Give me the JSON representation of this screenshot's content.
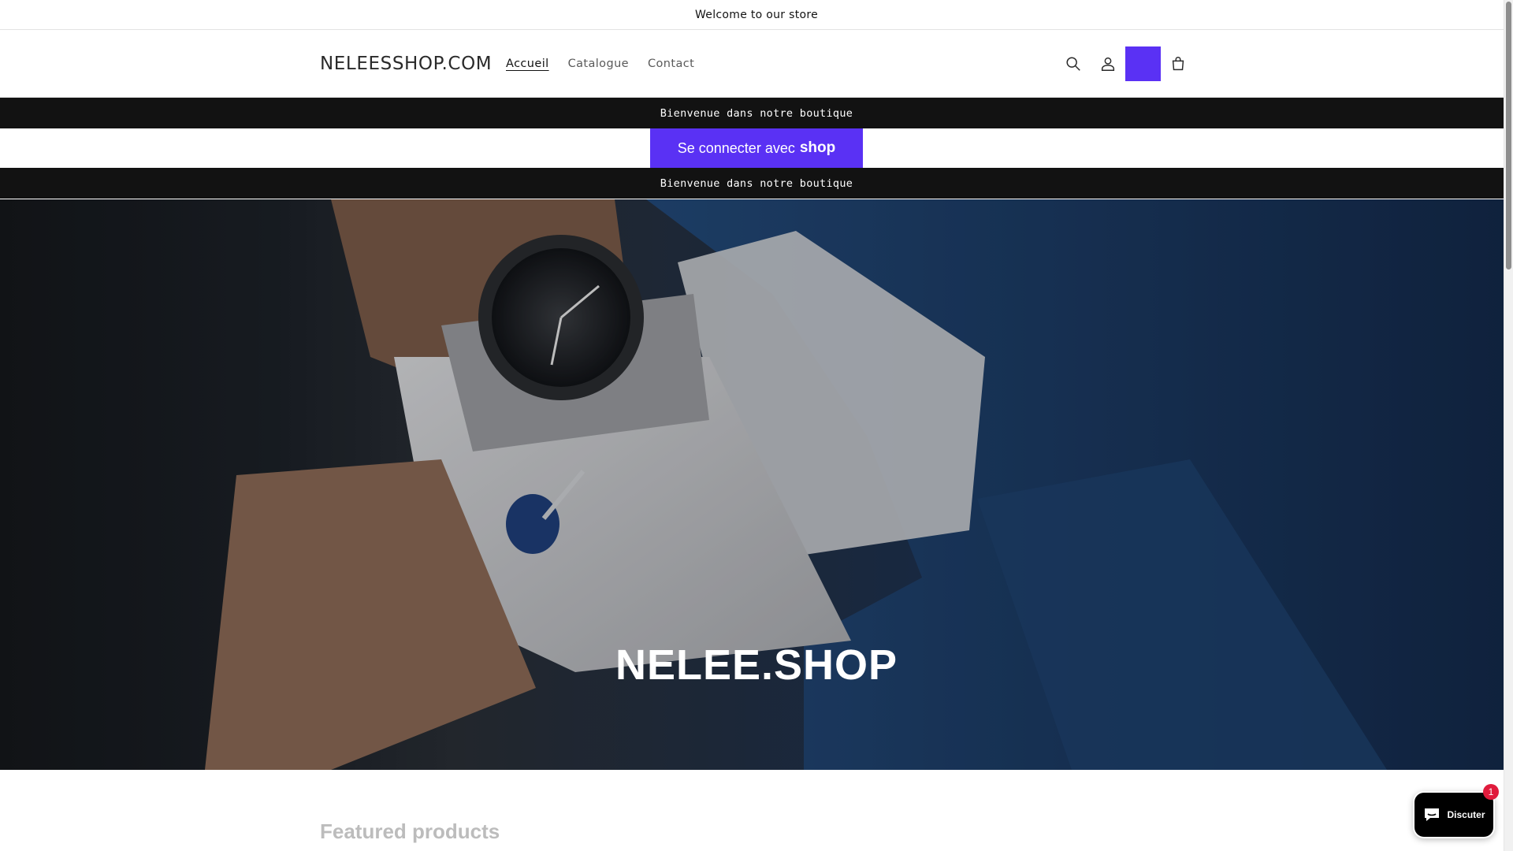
{
  "announcement": {
    "text": "Welcome to our store"
  },
  "header": {
    "logo": "NELEESSHOP.COM",
    "nav": [
      {
        "label": "Accueil",
        "active": true
      },
      {
        "label": "Catalogue",
        "active": false
      },
      {
        "label": "Contact",
        "active": false
      }
    ],
    "icons": [
      "search-icon",
      "account-icon",
      "cart-icon"
    ],
    "accent_color": "#5a31f4"
  },
  "banners": {
    "first": "Bienvenue dans notre boutique",
    "second": "Bienvenue dans notre boutique"
  },
  "shop_login": {
    "label": "Se connecter avec",
    "brand": "shop",
    "color": "#5a31f4"
  },
  "hero": {
    "title": "NELEE.SHOP"
  },
  "featured": {
    "title": "Featured products"
  },
  "chat": {
    "label": "Discuter",
    "badge": "1"
  }
}
